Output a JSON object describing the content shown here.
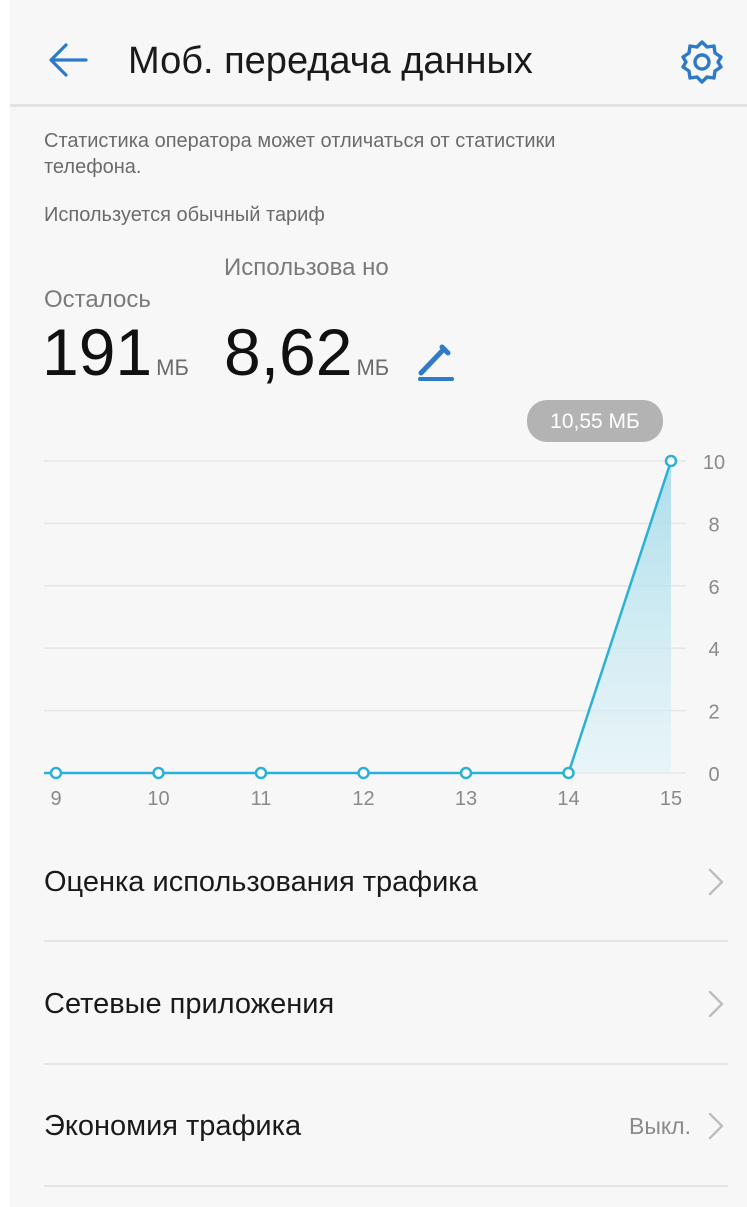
{
  "header": {
    "title": "Моб. передача данных",
    "back_icon": "arrow-left-icon",
    "settings_icon": "gear-icon",
    "accent_color": "#2f7ac7"
  },
  "notice": {
    "operator_note": "Статистика оператора может отличаться от статистики телефона.",
    "tariff": "Используется обычный тариф"
  },
  "usage": {
    "remaining_label": "Осталось",
    "remaining_value": "191",
    "remaining_unit": "МБ",
    "used_label": "Использова но",
    "used_value": "8,62",
    "used_unit": "МБ",
    "edit_icon": "pencil-icon"
  },
  "chart_data": {
    "type": "area",
    "x": [
      9,
      10,
      11,
      12,
      13,
      14,
      15
    ],
    "series": [
      {
        "values": [
          0,
          0,
          0,
          0,
          0,
          0,
          10
        ]
      }
    ],
    "ylim": [
      0,
      10
    ],
    "y_ticks": [
      0,
      2,
      4,
      6,
      8,
      10
    ],
    "x_tick_labels": [
      "9",
      "10",
      "11",
      "12",
      "13",
      "14",
      "15"
    ],
    "y_tick_labels": [
      "0",
      "2",
      "4",
      "6",
      "8",
      "10"
    ],
    "tooltip": "10,55 МБ",
    "grid": true,
    "y_axis_side": "right",
    "line_color": "#2bb1d6"
  },
  "menu": {
    "items": [
      {
        "label": "Оценка использования трафика",
        "value": ""
      },
      {
        "label": "Сетевые приложения",
        "value": ""
      },
      {
        "label": "Экономия трафика",
        "value": "Выкл."
      }
    ]
  }
}
